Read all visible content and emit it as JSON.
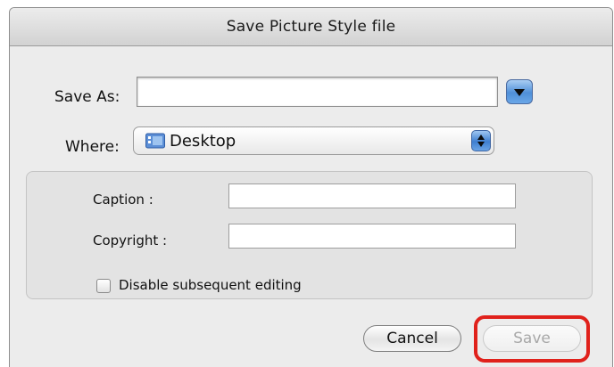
{
  "window": {
    "title": "Save Picture Style file"
  },
  "form": {
    "save_as_label": "Save As:",
    "save_as_value": "",
    "where_label": "Where:",
    "where_value": "Desktop"
  },
  "options": {
    "caption_label": "Caption :",
    "caption_value": "",
    "copyright_label": "Copyright :",
    "copyright_value": "",
    "disable_editing_label": "Disable subsequent editing",
    "disable_editing_checked": false
  },
  "buttons": {
    "cancel_label": "Cancel",
    "save_label": "Save",
    "save_enabled": false
  },
  "icons": {
    "expand": "chevron-down-icon",
    "folder": "desktop-folder-icon",
    "stepper": "up-down-arrows-icon"
  },
  "colors": {
    "highlight": "#e0211b",
    "accent_blue": "#4f8fd8"
  }
}
